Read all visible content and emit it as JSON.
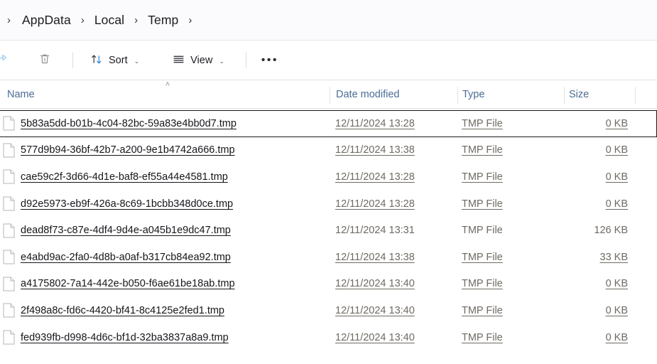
{
  "breadcrumb": {
    "leading_chevron": "›",
    "items": [
      "AppData",
      "Local",
      "Temp"
    ],
    "separator": "›",
    "trailing_chevron": "›"
  },
  "toolbar": {
    "share_icon": "share-icon",
    "delete_icon": "trash-icon",
    "sort_label": "Sort",
    "sort_icon": "sort-arrows-icon",
    "view_label": "View",
    "view_icon": "list-view-icon",
    "overflow_label": "•••",
    "chevron": "⌄"
  },
  "columns": {
    "name": "Name",
    "date_modified": "Date modified",
    "type": "Type",
    "size": "Size",
    "sort_indicator": "˄"
  },
  "files": [
    {
      "name": "5b83a5dd-b01b-4c04-82bc-59a83e4bb0d7.tmp",
      "date": "12/11/2024 13:28",
      "type": "TMP File",
      "size": "0 KB",
      "focused": true,
      "underlined": true
    },
    {
      "name": "577d9b94-36bf-42b7-a200-9e1b4742a666.tmp",
      "date": "12/11/2024 13:38",
      "type": "TMP File",
      "size": "0 KB",
      "focused": false,
      "underlined": true
    },
    {
      "name": "cae59c2f-3d66-4d1e-baf8-ef55a44e4581.tmp",
      "date": "12/11/2024 13:28",
      "type": "TMP File",
      "size": "0 KB",
      "focused": false,
      "underlined": true
    },
    {
      "name": "d92e5973-eb9f-426a-8c69-1bcbb348d0ce.tmp",
      "date": "12/11/2024 13:28",
      "type": "TMP File",
      "size": "0 KB",
      "focused": false,
      "underlined": true
    },
    {
      "name": "dead8f73-c87e-4df4-9d4e-a045b1e9dc47.tmp",
      "date": "12/11/2024 13:31",
      "type": "TMP File",
      "size": "126 KB",
      "focused": false,
      "underlined": false
    },
    {
      "name": "e4abd9ac-2fa0-4d8b-a0af-b317cb84ea92.tmp",
      "date": "12/11/2024 13:38",
      "type": "TMP File",
      "size": "33 KB",
      "focused": false,
      "underlined": true
    },
    {
      "name": "a4175802-7a14-442e-b050-f6ae61be18ab.tmp",
      "date": "12/11/2024 13:40",
      "type": "TMP File",
      "size": "0 KB",
      "focused": false,
      "underlined": true
    },
    {
      "name": "2f498a8c-fd6c-4420-bf41-8c4125e2fed1.tmp",
      "date": "12/11/2024 13:40",
      "type": "TMP File",
      "size": "0 KB",
      "focused": false,
      "underlined": true
    },
    {
      "name": "fed939fb-d998-4d6c-bf1d-32ba3837a8a9.tmp",
      "date": "12/11/2024 13:40",
      "type": "TMP File",
      "size": "0 KB",
      "focused": false,
      "underlined": true
    }
  ],
  "colors": {
    "header_text": "#4a6c94",
    "filename_text": "#15161a",
    "meta_text": "#6f6a63",
    "breadcrumb_bg": "#fbfbfd",
    "share_icon": "#9ccdf0",
    "sort_accent": "#2a7fd4",
    "focus_outline": "#1a1a1a"
  }
}
